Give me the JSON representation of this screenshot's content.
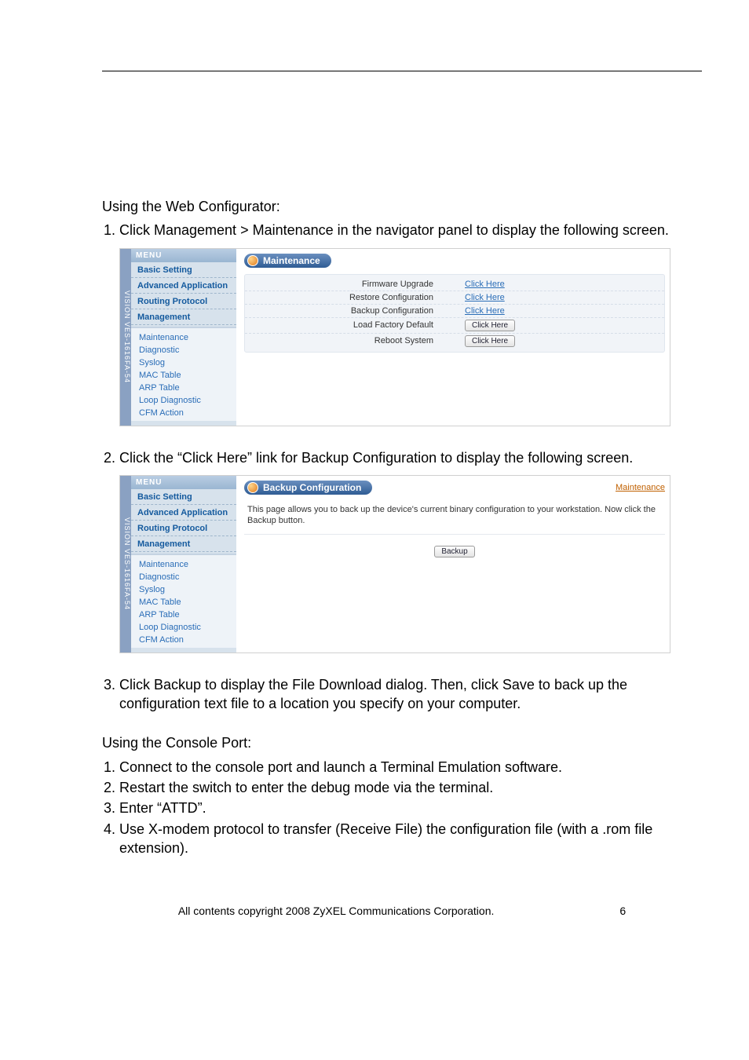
{
  "intro1": "Using the Web Configurator:",
  "steps1": [
    "Click Management > Maintenance in the navigator panel to display the following screen."
  ],
  "shot_common": {
    "vstrip": "VISION VES-1616FA-54",
    "menu_header": "MENU",
    "main_items": [
      "Basic Setting",
      "Advanced Application",
      "Routing Protocol",
      "Management"
    ],
    "sub_items": [
      "Maintenance",
      "Diagnostic",
      "Syslog",
      "MAC Table",
      "ARP Table",
      "Loop Diagnostic",
      "CFM Action"
    ]
  },
  "shot1": {
    "title": "Maintenance",
    "rows": [
      {
        "label": "Firmware Upgrade",
        "action_type": "link",
        "action": "Click Here"
      },
      {
        "label": "Restore Configuration",
        "action_type": "link",
        "action": "Click Here"
      },
      {
        "label": "Backup Configuration",
        "action_type": "link",
        "action": "Click Here"
      },
      {
        "label": "Load Factory Default",
        "action_type": "button",
        "action": "Click Here"
      },
      {
        "label": "Reboot System",
        "action_type": "button",
        "action": "Click Here"
      }
    ]
  },
  "step2_text": "Click the “Click Here” link for Backup Configuration to display the following screen.",
  "shot2": {
    "title": "Backup Configuration",
    "right_link": "Maintenance",
    "desc": "This page allows you to back up the device's current binary configuration to your workstation. Now click the Backup button.",
    "button": "Backup"
  },
  "step3_text": "Click Backup to display the File Download dialog. Then, click Save to back up the configuration text file to a location you specify on your computer.",
  "intro2": "Using the Console Port:",
  "steps2": [
    "Connect to the console port and launch a Terminal Emulation software.",
    "Restart the switch to enter the debug mode via the terminal.",
    "Enter “ATTD”.",
    "Use X-modem protocol to transfer (Receive File) the configuration file (with a .rom file extension)."
  ],
  "footer_left": "All contents copyright 2008 ZyXEL Communications Corporation.",
  "footer_right": "6"
}
